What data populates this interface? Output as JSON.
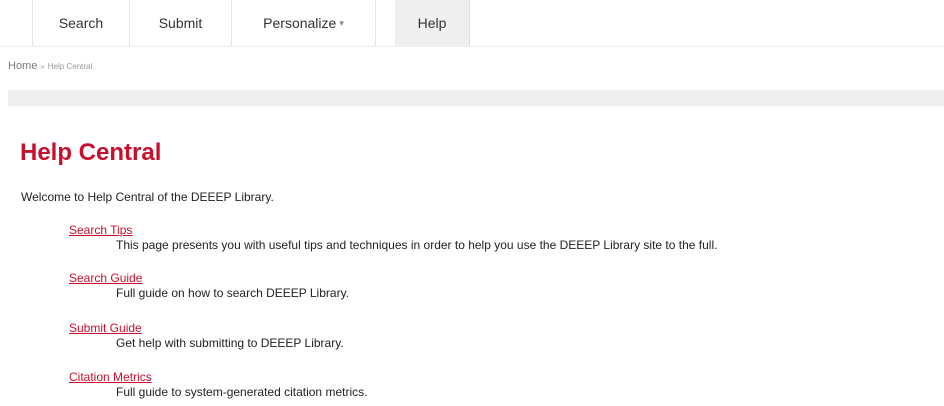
{
  "nav": {
    "tabs": [
      {
        "label": "Search"
      },
      {
        "label": "Submit"
      },
      {
        "label": "Personalize"
      },
      {
        "label": "Help"
      }
    ],
    "personalize_caret": "▾"
  },
  "breadcrumb": {
    "home": "Home",
    "separator": "»",
    "current": "Help Central"
  },
  "main": {
    "title": "Help Central",
    "welcome": "Welcome to Help Central of the DEEEP Library.",
    "entries": [
      {
        "link": "Search Tips",
        "description": "This page presents you with useful tips and techniques in order to help you use the DEEEP Library site to the full."
      },
      {
        "link": "Search Guide",
        "description": "Full guide on how to search DEEEP Library."
      },
      {
        "link": "Submit Guide",
        "description": "Get help with submitting to DEEEP Library."
      },
      {
        "link": "Citation Metrics",
        "description": "Full guide to system-generated citation metrics."
      }
    ]
  },
  "colors": {
    "accent": "#c8102e",
    "active_tab_bg": "#efefef",
    "grey_bar": "#eeeeee"
  }
}
